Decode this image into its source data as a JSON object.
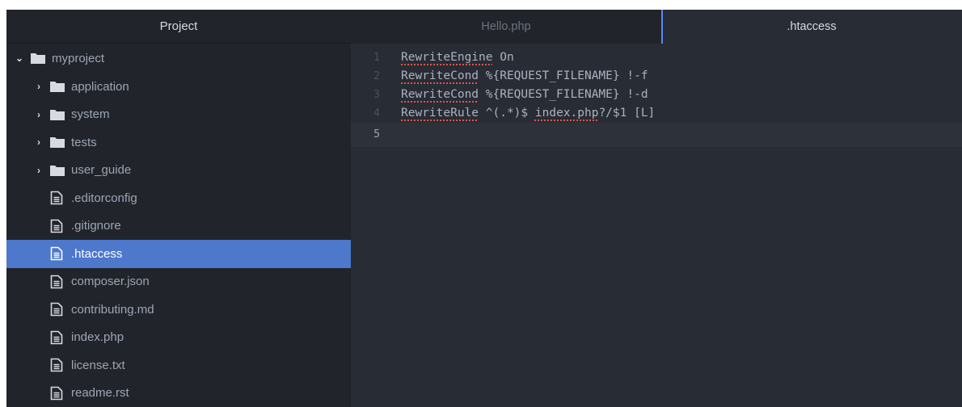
{
  "sidebar": {
    "header": "Project",
    "root": {
      "label": "myproject",
      "expanded": true
    },
    "folders": [
      {
        "label": "application"
      },
      {
        "label": "system"
      },
      {
        "label": "tests"
      },
      {
        "label": "user_guide"
      }
    ],
    "files": [
      {
        "label": ".editorconfig"
      },
      {
        "label": ".gitignore"
      },
      {
        "label": ".htaccess",
        "selected": true
      },
      {
        "label": "composer.json"
      },
      {
        "label": "contributing.md"
      },
      {
        "label": "index.php"
      },
      {
        "label": "license.txt"
      },
      {
        "label": "readme.rst"
      }
    ]
  },
  "tabs": [
    {
      "label": "Hello.php",
      "active": false
    },
    {
      "label": ".htaccess",
      "active": true
    }
  ],
  "editor": {
    "lines": [
      {
        "num": "1",
        "parts": [
          {
            "t": "RewriteEngine",
            "spell": true
          },
          {
            "t": " On"
          }
        ]
      },
      {
        "num": "2",
        "parts": [
          {
            "t": "RewriteCond",
            "spell": true
          },
          {
            "t": " %{REQUEST_FILENAME} !-f"
          }
        ]
      },
      {
        "num": "3",
        "parts": [
          {
            "t": "RewriteCond",
            "spell": true
          },
          {
            "t": " %{REQUEST_FILENAME} !-d"
          }
        ]
      },
      {
        "num": "4",
        "parts": [
          {
            "t": "RewriteRule",
            "spell": true
          },
          {
            "t": " ^(.*)$ "
          },
          {
            "t": "index.php",
            "spell": true
          },
          {
            "t": "?/$1 [L]"
          }
        ]
      },
      {
        "num": "5",
        "parts": []
      }
    ],
    "current_line": 5
  },
  "colors": {
    "selection": "#4d78cc",
    "spellcheck": "#e05252",
    "tab_accent": "#568af2"
  },
  "icons": {
    "folder": "folder-icon",
    "file": "file-text-icon",
    "collapsed": "chevron-right-icon",
    "expanded": "chevron-down-icon"
  }
}
